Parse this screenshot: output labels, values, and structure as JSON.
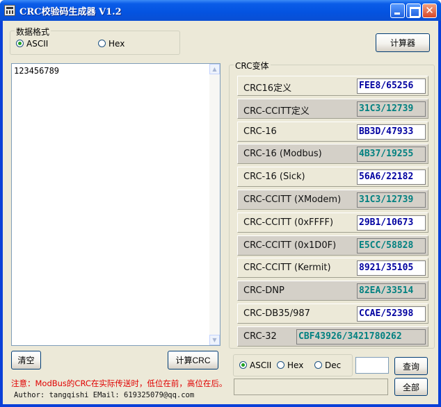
{
  "window": {
    "title": "CRC校验码生成器 V1.2"
  },
  "data_format": {
    "legend": "数据格式",
    "options": [
      {
        "label": "ASCII",
        "selected": true
      },
      {
        "label": "Hex",
        "selected": false
      }
    ]
  },
  "calculator_label": "计算器",
  "input": {
    "value": "123456789"
  },
  "crc_group": {
    "legend": "CRC变体",
    "rows": [
      {
        "label": "CRC16定义",
        "value": "FEE8/65256"
      },
      {
        "label": "CRC-CCITT定义",
        "value": "31C3/12739"
      },
      {
        "label": "CRC-16",
        "value": "BB3D/47933"
      },
      {
        "label": "CRC-16 (Modbus)",
        "value": "4B37/19255"
      },
      {
        "label": "CRC-16 (Sick)",
        "value": "56A6/22182"
      },
      {
        "label": "CRC-CCITT (XModem)",
        "value": "31C3/12739"
      },
      {
        "label": "CRC-CCITT (0xFFFF)",
        "value": "29B1/10673"
      },
      {
        "label": "CRC-CCITT (0x1D0F)",
        "value": "E5CC/58828"
      },
      {
        "label": "CRC-CCITT (Kermit)",
        "value": "8921/35105"
      },
      {
        "label": "CRC-DNP",
        "value": "82EA/33514"
      },
      {
        "label": "CRC-DB35/987",
        "value": "CCAE/52398"
      },
      {
        "label": "CRC-32",
        "value": "CBF43926/3421780262"
      }
    ]
  },
  "buttons": {
    "clear": "清空",
    "compute": "计算CRC",
    "query": "查询",
    "all": "全部"
  },
  "query_format": {
    "options": [
      {
        "label": "ASCII",
        "selected": true
      },
      {
        "label": "Hex",
        "selected": false
      },
      {
        "label": "Dec",
        "selected": false
      }
    ],
    "input_value": "",
    "result_value": ""
  },
  "note": "注意：ModBus的CRC在实际传送时，低位在前，高位在后。",
  "author": "Author: tangqishi    EMail: 619325079@qq.com",
  "colors": {
    "titlebar": "#0453e0",
    "dialog_bg": "#ece9d8",
    "value_blue": "#0000a0",
    "value_teal": "#008080",
    "note_red": "#e00000"
  }
}
